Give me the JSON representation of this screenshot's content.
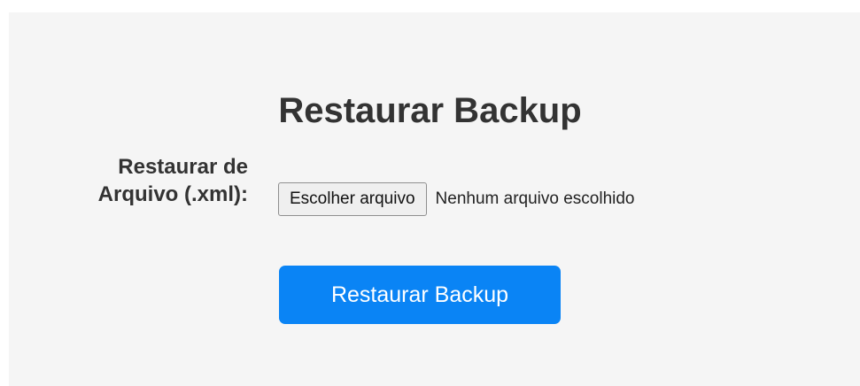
{
  "form": {
    "title": "Restaurar Backup",
    "file_label": "Restaurar de Arquivo (.xml):",
    "choose_button": "Escolher arquivo",
    "file_status": "Nenhum arquivo escolhido",
    "submit_button": "Restaurar Backup"
  },
  "colors": {
    "panel_background": "#f5f5f5",
    "text": "#333333",
    "accent": "#0a84f5"
  }
}
